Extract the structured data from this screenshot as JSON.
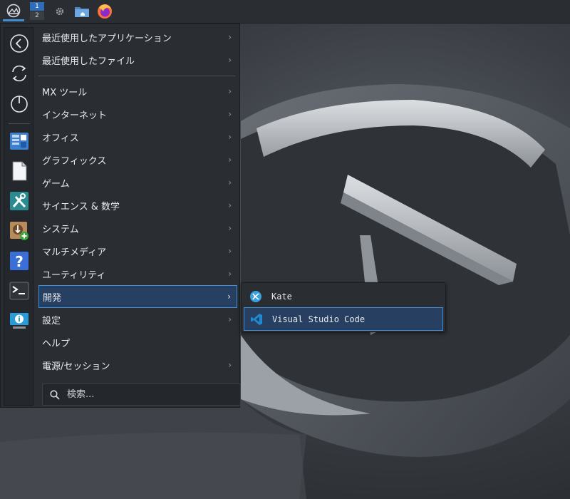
{
  "taskbar": {
    "launcher_icon": "mx-logo-icon",
    "pager": {
      "desk1": "1",
      "desk2": "2"
    },
    "apps": [
      "settings-gear-icon",
      "file-manager-icon",
      "firefox-icon"
    ]
  },
  "sidebar": {
    "buttons": [
      "back-arrow-icon",
      "refresh-icon",
      "power-icon"
    ],
    "favorites": [
      "mx-package-installer-icon",
      "document-icon",
      "mx-tools-icon",
      "package-add-icon",
      "help-icon",
      "terminal-icon",
      "system-info-icon"
    ]
  },
  "menu": {
    "items": [
      {
        "label": "最近使用したアプリケーション"
      },
      {
        "label": "最近使用したファイル"
      },
      {
        "label": "MX ツール"
      },
      {
        "label": "インターネット"
      },
      {
        "label": "オフィス"
      },
      {
        "label": "グラフィックス"
      },
      {
        "label": "ゲーム"
      },
      {
        "label": "サイエンス & 数学"
      },
      {
        "label": "システム"
      },
      {
        "label": "マルチメディア"
      },
      {
        "label": "ユーティリティ"
      },
      {
        "label": "開発"
      },
      {
        "label": "設定"
      },
      {
        "label": "ヘルプ"
      },
      {
        "label": "電源/セッション"
      }
    ],
    "arrow": "›",
    "search_placeholder": "検索..."
  },
  "submenu": {
    "items": [
      {
        "label": "Kate"
      },
      {
        "label": "Visual Studio Code"
      }
    ]
  },
  "colors": {
    "accent": "#3d8fd8",
    "highlight_bg": "#274062",
    "menu_bg": "#2a2e32"
  }
}
